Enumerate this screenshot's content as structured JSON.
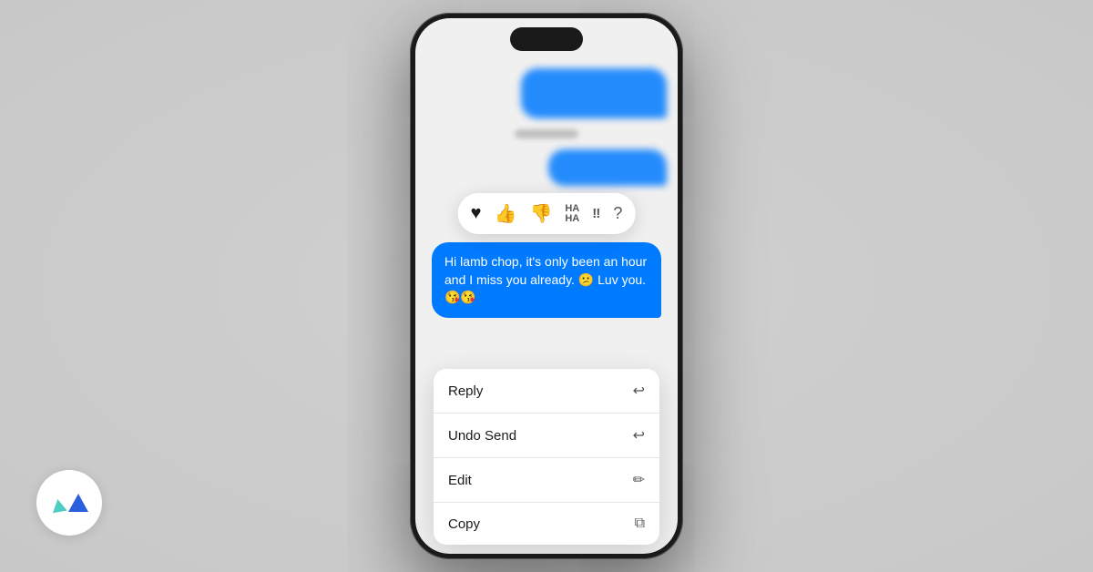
{
  "background": {
    "color": "#d8d8d8"
  },
  "phone": {
    "message": {
      "text": "Hi lamb chop, it's only been an hour and I miss you already. 😕 Luv you. 😘😘"
    },
    "reactions": [
      {
        "name": "heart",
        "emoji": "♥",
        "label": "heart-reaction"
      },
      {
        "name": "thumbs-up",
        "emoji": "👍",
        "label": "thumbs-up-reaction"
      },
      {
        "name": "thumbs-down",
        "emoji": "👎",
        "label": "thumbs-down-reaction"
      },
      {
        "name": "haha",
        "text": "HA\nHA",
        "label": "haha-reaction"
      },
      {
        "name": "exclamation",
        "text": "‼",
        "label": "exclamation-reaction"
      },
      {
        "name": "question",
        "text": "?",
        "label": "question-reaction"
      }
    ],
    "context_menu": {
      "items": [
        {
          "id": "reply",
          "label": "Reply",
          "icon": "↩"
        },
        {
          "id": "undo-send",
          "label": "Undo Send",
          "icon": "↩"
        },
        {
          "id": "edit",
          "label": "Edit",
          "icon": "✏"
        },
        {
          "id": "copy",
          "label": "Copy",
          "icon": "⧉"
        }
      ]
    }
  },
  "logo": {
    "alt": "ApiDeck logo"
  }
}
